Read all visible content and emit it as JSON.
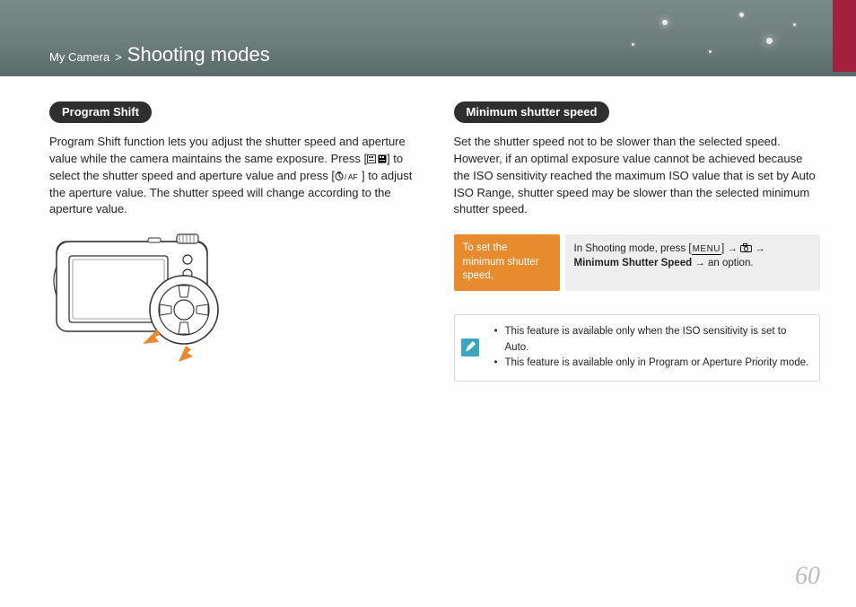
{
  "header": {
    "breadcrumb_root": "My Camera",
    "breadcrumb_sep": ">",
    "section_title": "Shooting modes"
  },
  "left": {
    "pill": "Program Shift",
    "para_1": "Program Shift function lets you adjust the shutter speed and aperture value while the camera maintains the same exposure. Press [",
    "para_2": "] to select the shutter speed and aperture value and press [",
    "para_3": "] to adjust the aperture value. The shutter speed will change according to the aperture value.",
    "icon1_name": "display-icon",
    "icon2_name": "timer-af-icon"
  },
  "right": {
    "pill": "Minimum shutter speed",
    "para": "Set the shutter speed not to be slower than the selected speed. However, if an optimal exposure value cannot be achieved because the ISO sensitivity reached the maximum ISO value that is set by Auto ISO Range, shutter speed may be slower than the selected minimum shutter speed.",
    "howto_label": "To set the minimum shutter speed,",
    "howto_pre": "In Shooting mode, press [",
    "howto_menu": "MENU",
    "howto_mid1": "] → ",
    "howto_cam_icon": "camera-icon",
    "howto_mid2": " → ",
    "howto_bold": "Minimum Shutter Speed",
    "howto_post": " → an option.",
    "notes": [
      "This feature is available only when the ISO sensitivity is set to Auto.",
      "This feature is available only in Program or Aperture Priority mode."
    ]
  },
  "page_number": "60"
}
